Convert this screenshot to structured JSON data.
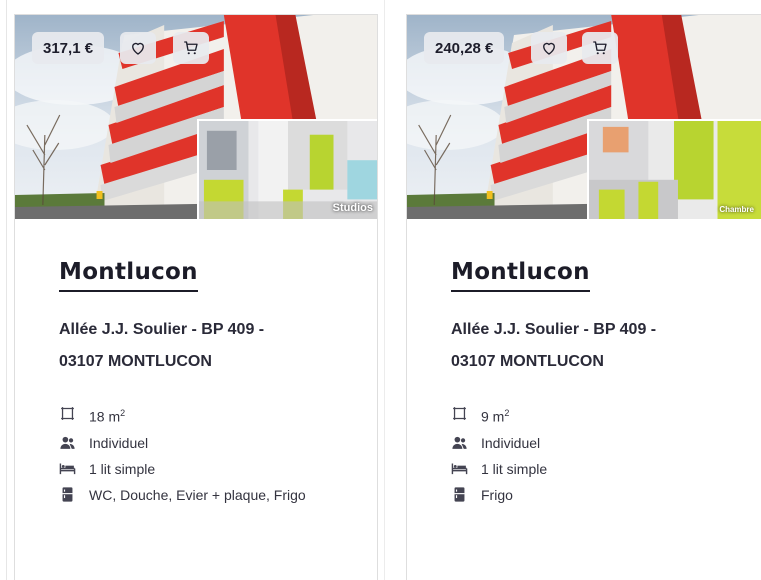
{
  "colors": {
    "building_red": "#e0342a",
    "text_dark": "#1c1c28",
    "pill_bg": "#e8eaee",
    "accent_green": "#b8d430"
  },
  "cards": [
    {
      "price": "317,1 €",
      "photo_label": "Studios",
      "title": "Montlucon",
      "address_line1": "Allée J.J. Soulier - BP 409 -",
      "address_line2": "03107 MONTLUCON",
      "features": [
        {
          "icon": "area-icon",
          "text": "18 m",
          "sup": "2"
        },
        {
          "icon": "person-icon",
          "text": "Individuel"
        },
        {
          "icon": "bed-icon",
          "text": "1 lit simple"
        },
        {
          "icon": "fridge-icon",
          "text": "WC, Douche, Evier + plaque, Frigo"
        }
      ]
    },
    {
      "price": "240,28 €",
      "photo_label": "Chambre",
      "title": "Montlucon",
      "address_line1": "Allée J.J. Soulier - BP 409 -",
      "address_line2": "03107 MONTLUCON",
      "features": [
        {
          "icon": "area-icon",
          "text": "9 m",
          "sup": "2"
        },
        {
          "icon": "person-icon",
          "text": "Individuel"
        },
        {
          "icon": "bed-icon",
          "text": "1 lit simple"
        },
        {
          "icon": "fridge-icon",
          "text": "Frigo"
        }
      ]
    }
  ]
}
